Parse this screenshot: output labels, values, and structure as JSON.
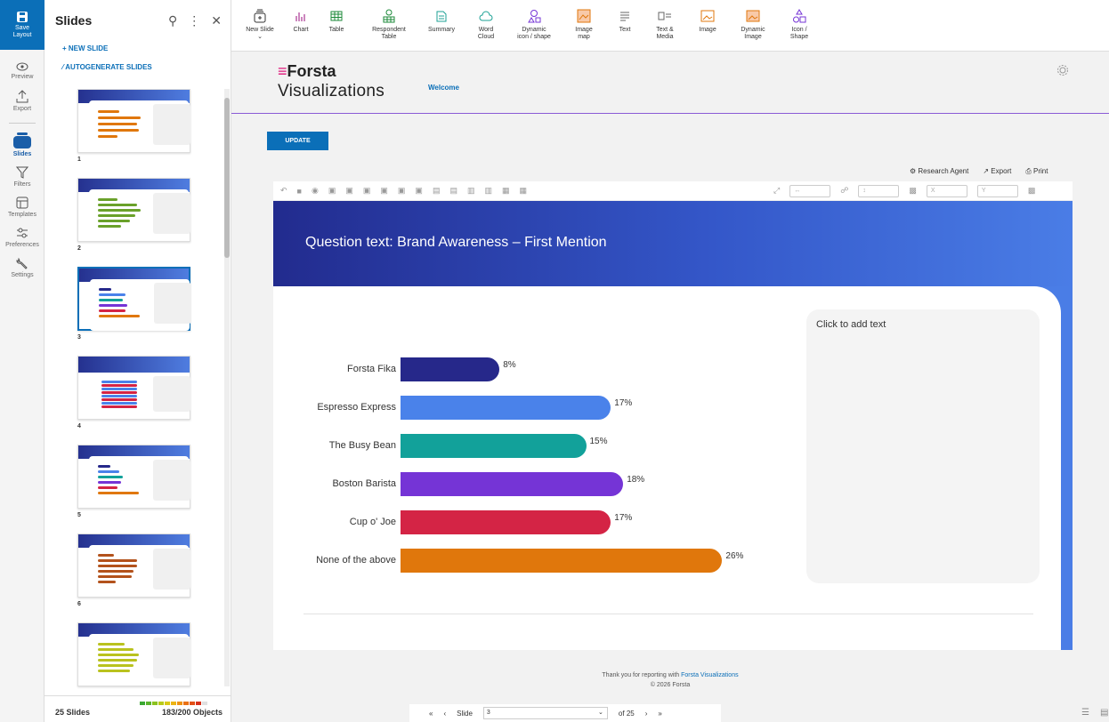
{
  "rail": {
    "save": "Save\nLayout",
    "save_l1": "Save",
    "save_l2": "Layout",
    "items": [
      {
        "label": "Preview"
      },
      {
        "label": "Export"
      },
      {
        "label": "Slides"
      },
      {
        "label": "Filters"
      },
      {
        "label": "Templates"
      },
      {
        "label": "Preferences"
      },
      {
        "label": "Settings"
      }
    ]
  },
  "panel": {
    "title": "Slides",
    "new_slide": "+ NEW SLIDE",
    "autogenerate": "AUTOGENERATE SLIDES",
    "thumb_numbers": [
      "1",
      "2",
      "3",
      "4",
      "5",
      "6"
    ],
    "slide_count": "25 Slides",
    "objects": "183/200 Objects"
  },
  "toolbar": {
    "items": [
      {
        "l1": "New Slide",
        "l2": ""
      },
      {
        "l1": "Chart",
        "l2": ""
      },
      {
        "l1": "Table",
        "l2": ""
      },
      {
        "l1": "Respondent",
        "l2": "Table"
      },
      {
        "l1": "Summary",
        "l2": ""
      },
      {
        "l1": "Word",
        "l2": "Cloud"
      },
      {
        "l1": "Dynamic",
        "l2": "icon / shape"
      },
      {
        "l1": "Image",
        "l2": "map"
      },
      {
        "l1": "Text",
        "l2": ""
      },
      {
        "l1": "Text &",
        "l2": "Media"
      },
      {
        "l1": "Image",
        "l2": ""
      },
      {
        "l1": "Dynamic",
        "l2": "Image"
      },
      {
        "l1": "Icon /",
        "l2": "Shape"
      }
    ]
  },
  "brand": {
    "logo_top": "Forsta",
    "logo_bottom": "Visualizations",
    "welcome": "Welcome"
  },
  "update_label": "UPDATE",
  "actions": {
    "research": "Research Agent",
    "export": "Export",
    "print": "Print"
  },
  "slide_toolbar": {
    "x": "X",
    "y": "Y"
  },
  "slide": {
    "title": "Question text: Brand Awareness – First Mention",
    "textbox": "Click to add text"
  },
  "chart_data": {
    "type": "bar",
    "orientation": "horizontal",
    "categories": [
      "Forsta Fika",
      "Espresso Express",
      "The Busy Bean",
      "Boston Barista",
      "Cup o' Joe",
      "None of the above"
    ],
    "values": [
      8,
      17,
      15,
      18,
      17,
      26
    ],
    "value_labels": [
      "8%",
      "17%",
      "15%",
      "18%",
      "17%",
      "26%"
    ],
    "colors": [
      "#26288a",
      "#4a82ea",
      "#12a19a",
      "#7534d6",
      "#d42445",
      "#e0770c"
    ],
    "xlim": [
      0,
      30
    ],
    "grid": false
  },
  "footer": {
    "line1_prefix": "Thank you for reporting with ",
    "line1_link": "Forsta Visualizations",
    "line2": "© 2026 Forsta"
  },
  "pager": {
    "slide_label": "Slide",
    "slide_value": "3",
    "of": "of 25"
  }
}
